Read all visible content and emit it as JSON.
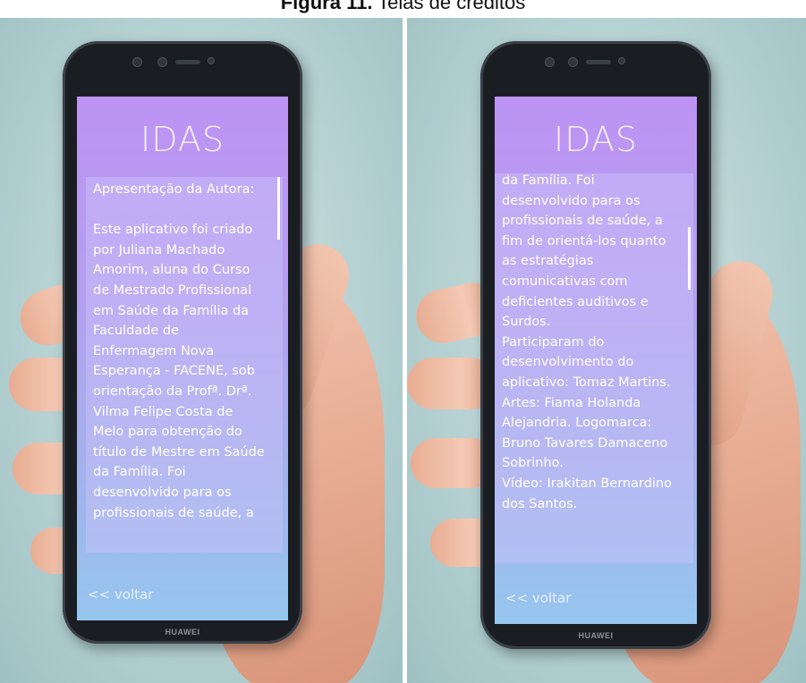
{
  "caption": {
    "bold": "Figura 11.",
    "text": " Telas de créditos"
  },
  "app_title": "IDAS",
  "back_label": "<< voltar",
  "phone_brand": "HUAWEI",
  "screen_left": {
    "text": "Apresentação da Autora:\n\nEste aplicativo foi criado\npor Juliana Machado\nAmorim, aluna do Curso\nde Mestrado Profissional\nem Saúde da Família da\nFaculdade de\nEnfermagem Nova\nEsperança - FACENE, sob\norientação da Profª. Drª.\nVilma Felipe Costa de\nMelo para obtenção do\ntítulo de Mestre em Saúde\nda Família. Foi\ndesenvolvido para os\nprofissionais de saúde, a"
  },
  "screen_right": {
    "text": "da Família. Foi\ndesenvolvido para os\nprofissionais de saúde, a\nfim de orientá-los quanto\nas estratégias\ncomunicativas com\ndeficientes auditivos e\nSurdos.\nParticiparam do\ndesenvolvimento do\naplicativo: Tomaz Martins.\nArtes: Fiama Holanda\nAlejandria. Logomarca:\nBruno Tavares Damaceno\nSobrinho.\nVídeo: Irakitan Bernardino\ndos Santos."
  }
}
